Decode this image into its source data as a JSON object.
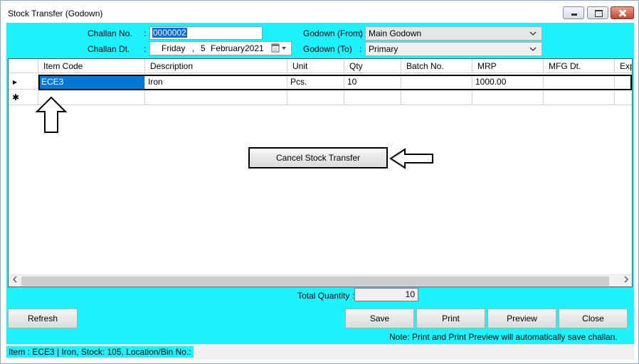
{
  "window": {
    "title": "Stock Transfer (Godown)"
  },
  "form": {
    "challan_no_label": "Challan No.",
    "challan_no_value": "0000002",
    "challan_dt_label": "Challan Dt.",
    "date_day": "Friday",
    "date_sep": ",",
    "date_daynum": "5",
    "date_month": "February",
    "date_year": "2021",
    "godown_from_label": "Godown (From)",
    "godown_from_value": "Main Godown",
    "godown_to_label": "Godown (To)",
    "godown_to_value": "Primary",
    "colon": ":"
  },
  "grid": {
    "columns": [
      "Item Code",
      "Description",
      "Unit",
      "Qty",
      "Batch No.",
      "MRP",
      "MFG Dt.",
      "Exp"
    ],
    "rows": [
      {
        "item_code": "ECE3",
        "description": "Iron",
        "unit": "Pcs.",
        "qty": "10",
        "batch_no": "",
        "mrp": "1000.00",
        "mfg_dt": "",
        "exp": ""
      }
    ],
    "current_row_marker": "▸",
    "new_row_marker": "✱"
  },
  "context_menu": {
    "cancel_label": "Cancel Stock Transfer"
  },
  "totals": {
    "label": "Total Quantity :",
    "value": "10"
  },
  "buttons": {
    "refresh": "Refresh",
    "save": "Save",
    "print": "Print",
    "preview": "Preview",
    "close": "Close"
  },
  "note": "Note: Print and Print Preview will automatically save challan.",
  "status": "Item : ECE3 | Iron, Stock: 105, Location/Bin No.:",
  "icons": {
    "minimize": "minimize-icon",
    "maximize": "maximize-icon",
    "close": "close-icon",
    "dropdown": "chevron-down-icon",
    "calendar": "calendar-icon",
    "scroll_left": "chevron-left-icon",
    "scroll_right": "chevron-right-icon"
  },
  "colors": {
    "form_bg": "#1ff2ff",
    "selection": "#0078d7"
  }
}
